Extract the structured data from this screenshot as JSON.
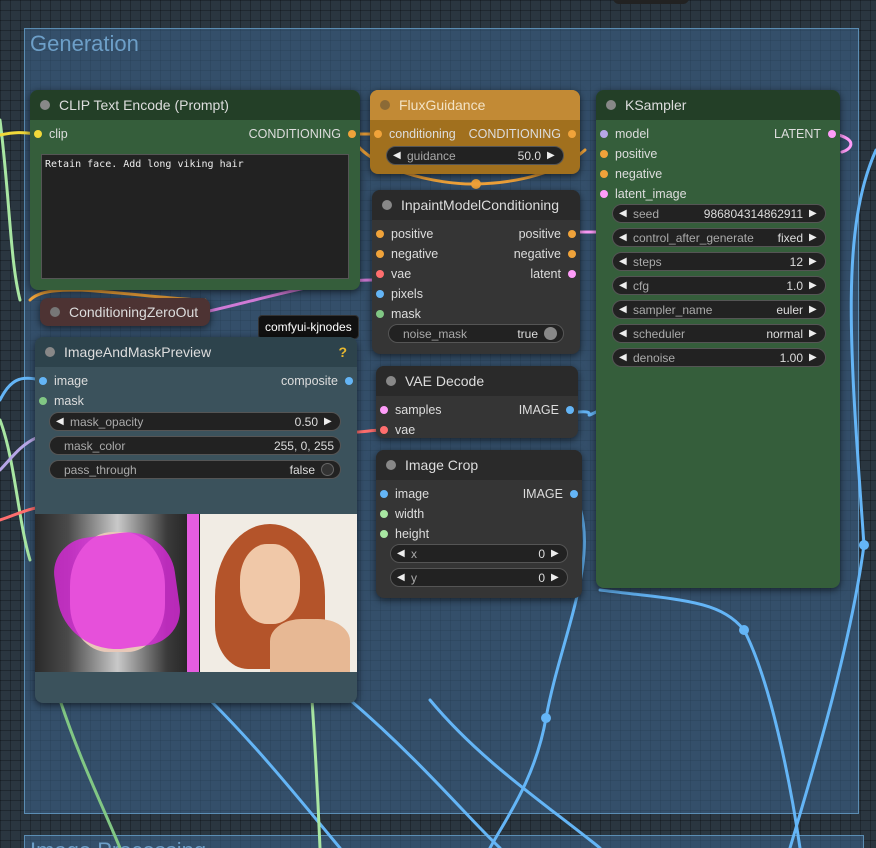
{
  "groups": {
    "generation": {
      "title": "Generation"
    },
    "processing": {
      "title": "Image Processing"
    }
  },
  "tooltip": "comfyui-kjnodes",
  "nodes": {
    "clip": {
      "title": "CLIP Text Encode (Prompt)",
      "input": "clip",
      "output": "CONDITIONING",
      "text": "Retain face. Add long viking hair"
    },
    "zero": {
      "title": "ConditioningZeroOut"
    },
    "flux": {
      "title": "FluxGuidance",
      "input": "conditioning",
      "output": "CONDITIONING",
      "guidance": {
        "label": "guidance",
        "value": "50.0"
      }
    },
    "inpaint": {
      "title": "InpaintModelConditioning",
      "inputs": [
        "positive",
        "negative",
        "vae",
        "pixels",
        "mask"
      ],
      "outputs": [
        "positive",
        "negative",
        "latent"
      ],
      "noise_mask": {
        "label": "noise_mask",
        "value": "true"
      }
    },
    "ksampler": {
      "title": "KSampler",
      "inputs": [
        "model",
        "positive",
        "negative",
        "latent_image"
      ],
      "output": "LATENT",
      "widgets": [
        {
          "label": "seed",
          "value": "986804314862911"
        },
        {
          "label": "control_after_generate",
          "value": "fixed"
        },
        {
          "label": "steps",
          "value": "12"
        },
        {
          "label": "cfg",
          "value": "1.0"
        },
        {
          "label": "sampler_name",
          "value": "euler"
        },
        {
          "label": "scheduler",
          "value": "normal"
        },
        {
          "label": "denoise",
          "value": "1.00"
        }
      ]
    },
    "preview": {
      "title": "ImageAndMaskPreview",
      "help": "?",
      "inputs": [
        "image",
        "mask"
      ],
      "output": "composite",
      "mask_opacity": {
        "label": "mask_opacity",
        "value": "0.50"
      },
      "mask_color": {
        "label": "mask_color",
        "value": "255, 0, 255"
      },
      "pass_through": {
        "label": "pass_through",
        "value": "false"
      }
    },
    "vae": {
      "title": "VAE Decode",
      "inputs": [
        "samples",
        "vae"
      ],
      "output": "IMAGE"
    },
    "crop": {
      "title": "Image Crop",
      "inputs": [
        "image",
        "width",
        "height"
      ],
      "output": "IMAGE",
      "x": {
        "label": "x",
        "value": "0"
      },
      "y": {
        "label": "y",
        "value": "0"
      }
    }
  },
  "colors": {
    "clip_yellow": "#f2d93a",
    "conditioning_orange": "#f0a33a",
    "model_lavender": "#b6a6e6",
    "latent_pink": "#ff9cf9",
    "vae_red": "#ff6e6e",
    "image_blue": "#64b5f6",
    "mask_green": "#81c784",
    "int_green": "#a8e6a2",
    "node_green": "#355e3b",
    "node_grey": "#353535",
    "node_teal": "#3b525c",
    "node_brown": "#a1701e",
    "node_maroon": "#4d3333"
  }
}
